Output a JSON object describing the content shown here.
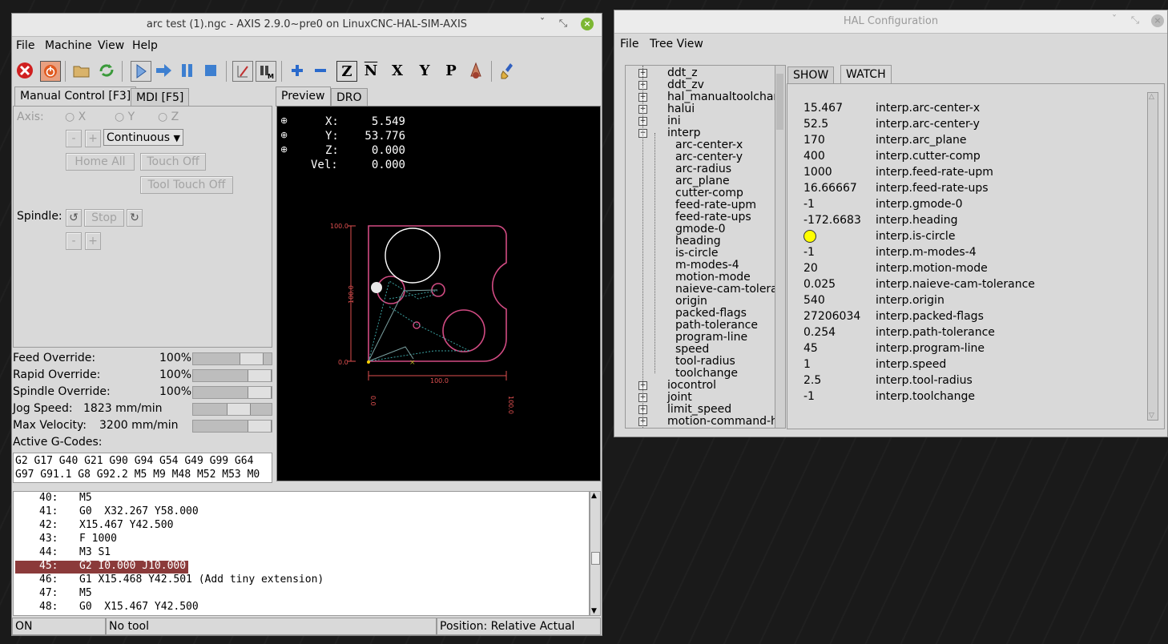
{
  "axis": {
    "title": "arc test (1).ngc - AXIS 2.9.0~pre0 on LinuxCNC-HAL-SIM-AXIS",
    "menu": [
      "File",
      "Machine",
      "View",
      "Help"
    ],
    "tabs": {
      "manual": "Manual Control [F3]",
      "mdi": "MDI [F5]"
    },
    "manual": {
      "axis_label": "Axis:",
      "axes": [
        "X",
        "Y",
        "Z"
      ],
      "minus": "-",
      "plus": "+",
      "increment": "Continuous",
      "home_all": "Home All",
      "touch_off": "Touch Off",
      "tool_touch_off": "Tool Touch Off",
      "spindle_label": "Spindle:",
      "stop": "Stop"
    },
    "overrides": {
      "feed_label": "Feed Override:",
      "feed_value": "100",
      "rapid_label": "Rapid Override:",
      "rapid_value": "100",
      "spindle_label": "Spindle Override:",
      "spindle_value": "100",
      "percent": "%",
      "jog_label": "Jog Speed:",
      "jog_value": "1823 mm/min",
      "maxvel_label": "Max Velocity:",
      "maxvel_value": "3200 mm/min"
    },
    "gcodes_label": "Active G-Codes:",
    "gcodes_line1": "G2 G17 G40 G21 G90 G94 G54 G49 G99 G64",
    "gcodes_line2": "G97 G91.1 G8 G92.2 M5 M9 M48 M52 M53 M0",
    "preview_tabs": {
      "preview": "Preview",
      "dro": "DRO"
    },
    "dro": {
      "x_label": "X:",
      "x_value": "5.549",
      "y_label": "Y:",
      "y_value": "53.776",
      "z_label": "Z:",
      "z_value": "0.000",
      "vel_label": "Vel:",
      "vel_value": "0.000"
    },
    "plot_labels": {
      "y_top": "100.0",
      "y_mid": "100.0",
      "y_bottom": "0.0",
      "x_mid": "100.0",
      "x_left": "0.0",
      "x_right": "100.0"
    },
    "gcode_lines": [
      {
        "num": "40:",
        "code": "M5"
      },
      {
        "num": "41:",
        "code": "G0  X32.267 Y58.000"
      },
      {
        "num": "42:",
        "code": "X15.467 Y42.500"
      },
      {
        "num": "43:",
        "code": "F 1000"
      },
      {
        "num": "44:",
        "code": "M3 S1"
      },
      {
        "num": "45:",
        "code": "G2 I0.000 J10.000"
      },
      {
        "num": "46:",
        "code": "G1 X15.468 Y42.501 (Add tiny extension)"
      },
      {
        "num": "47:",
        "code": "M5"
      },
      {
        "num": "48:",
        "code": "G0  X15.467 Y42.500"
      }
    ],
    "status": {
      "state": "ON",
      "tool": "No tool",
      "position": "Position: Relative Actual"
    },
    "colors": {
      "highlight": "#8b3a3a",
      "plot_path": "#d24b83",
      "dro_text": "#ffffff"
    }
  },
  "hal": {
    "title": "HAL Configuration",
    "menu": [
      "File",
      "Tree View"
    ],
    "tree": [
      {
        "label": "ddt_z",
        "level": 0
      },
      {
        "label": "ddt_zv",
        "level": 0
      },
      {
        "label": "hal_manualtoolchan",
        "level": 0
      },
      {
        "label": "halui",
        "level": 0
      },
      {
        "label": "ini",
        "level": 0
      },
      {
        "label": "interp",
        "level": 0
      },
      {
        "label": "arc-center-x",
        "level": 1
      },
      {
        "label": "arc-center-y",
        "level": 1
      },
      {
        "label": "arc-radius",
        "level": 1
      },
      {
        "label": "arc_plane",
        "level": 1
      },
      {
        "label": "cutter-comp",
        "level": 1
      },
      {
        "label": "feed-rate-upm",
        "level": 1
      },
      {
        "label": "feed-rate-ups",
        "level": 1
      },
      {
        "label": "gmode-0",
        "level": 1
      },
      {
        "label": "heading",
        "level": 1
      },
      {
        "label": "is-circle",
        "level": 1
      },
      {
        "label": "m-modes-4",
        "level": 1
      },
      {
        "label": "motion-mode",
        "level": 1
      },
      {
        "label": "naieve-cam-tolera",
        "level": 1
      },
      {
        "label": "origin",
        "level": 1
      },
      {
        "label": "packed-flags",
        "level": 1
      },
      {
        "label": "path-tolerance",
        "level": 1
      },
      {
        "label": "program-line",
        "level": 1
      },
      {
        "label": "speed",
        "level": 1
      },
      {
        "label": "tool-radius",
        "level": 1
      },
      {
        "label": "toolchange",
        "level": 1
      },
      {
        "label": "iocontrol",
        "level": 0
      },
      {
        "label": "joint",
        "level": 0
      },
      {
        "label": "limit_speed",
        "level": 0
      },
      {
        "label": "motion-command-ha",
        "level": 0
      }
    ],
    "tabs": {
      "show": "SHOW",
      "watch": "WATCH"
    },
    "watch": [
      {
        "value": "15.467",
        "name": "interp.arc-center-x"
      },
      {
        "value": "52.5",
        "name": "interp.arc-center-y"
      },
      {
        "value": "170",
        "name": "interp.arc_plane"
      },
      {
        "value": "400",
        "name": "interp.cutter-comp"
      },
      {
        "value": "1000",
        "name": "interp.feed-rate-upm"
      },
      {
        "value": "16.66667",
        "name": "interp.feed-rate-ups"
      },
      {
        "value": "-1",
        "name": "interp.gmode-0"
      },
      {
        "value": "-172.6683",
        "name": "interp.heading"
      },
      {
        "value": "",
        "name": "interp.is-circle",
        "led": "#ffff00"
      },
      {
        "value": "-1",
        "name": "interp.m-modes-4"
      },
      {
        "value": "20",
        "name": "interp.motion-mode"
      },
      {
        "value": "0.025",
        "name": "interp.naieve-cam-tolerance"
      },
      {
        "value": "540",
        "name": "interp.origin"
      },
      {
        "value": "27206034",
        "name": "interp.packed-flags"
      },
      {
        "value": "0.254",
        "name": "interp.path-tolerance"
      },
      {
        "value": "45",
        "name": "interp.program-line"
      },
      {
        "value": "1",
        "name": "interp.speed"
      },
      {
        "value": "2.5",
        "name": "interp.tool-radius"
      },
      {
        "value": "-1",
        "name": "interp.toolchange"
      }
    ]
  }
}
